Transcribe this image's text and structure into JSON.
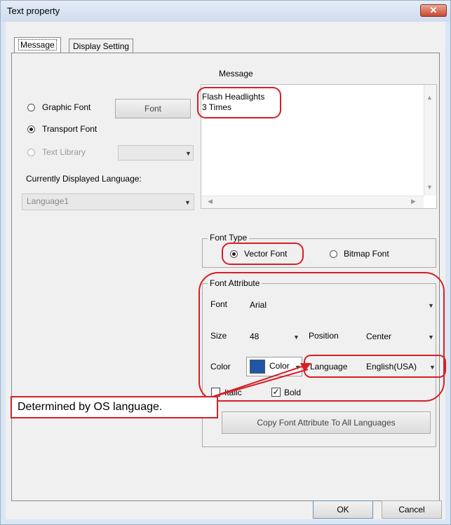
{
  "window": {
    "title": "Text property",
    "close_glyph": "✕"
  },
  "tabs": [
    "Message",
    "Display Setting"
  ],
  "left": {
    "radio_graphic": "Graphic Font",
    "font_button": "Font",
    "radio_transport": "Transport Font",
    "radio_textlib": "Text Library",
    "current_lang_label": "Currently Displayed Language:",
    "language_value": "Language1",
    "selected_font_source": "Transport Font"
  },
  "message": {
    "label": "Message",
    "line1": "Flash Headlights",
    "line2": "3 Times"
  },
  "font_type": {
    "legend": "Font Type",
    "vector": "Vector Font",
    "bitmap": "Bitmap Font",
    "selected": "Vector Font"
  },
  "font_attr": {
    "legend": "Font Attribute",
    "font_label": "Font",
    "font_value": "Arial",
    "size_label": "Size",
    "size_value": "48",
    "position_label": "Position",
    "position_value": "Center",
    "color_label": "Color",
    "color_button": "Color",
    "color_swatch": "#1f56a7",
    "language_label": "Language",
    "language_value": "English(USA)",
    "italic": "Italic",
    "bold": "Bold",
    "italic_checked": false,
    "bold_checked": true,
    "copy_button": "Copy Font Attribute To All Languages"
  },
  "annotation": {
    "callout": "Determined by OS language.",
    "accent": "#d61f26"
  },
  "footer": {
    "ok": "OK",
    "cancel": "Cancel"
  }
}
